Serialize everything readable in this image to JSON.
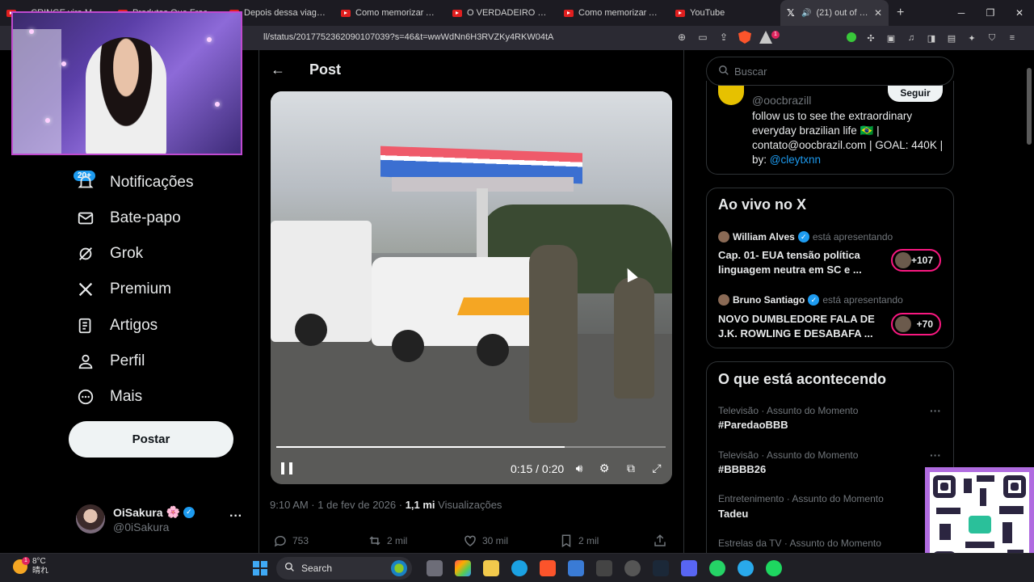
{
  "browser": {
    "tabs": [
      {
        "title": "... CRINGE vira MOD..."
      },
      {
        "title": "Produtos Que Fracas..."
      },
      {
        "title": "Depois dessa viagem, e..."
      },
      {
        "title": "Como memorizar ABSC..."
      },
      {
        "title": "O VERDADEIRO MOTIV..."
      },
      {
        "title": "Como memorizar ABSC..."
      },
      {
        "title": "YouTube"
      },
      {
        "title": "(21) out of cont..."
      }
    ],
    "new_tab": "+",
    "url": "ll/status/2017752362090107039?s=46&t=wwWdNn6H3RVZKy4RKW04tA",
    "notif_count": "1"
  },
  "nav": {
    "badge": "20+",
    "items": [
      {
        "label": "Notificações",
        "icon": "bell-icon"
      },
      {
        "label": "Bate-papo",
        "icon": "mail-icon"
      },
      {
        "label": "Grok",
        "icon": "grok-icon"
      },
      {
        "label": "Premium",
        "icon": "x-logo-icon"
      },
      {
        "label": "Artigos",
        "icon": "article-icon"
      },
      {
        "label": "Perfil",
        "icon": "person-icon"
      },
      {
        "label": "Mais",
        "icon": "more-circle-icon"
      }
    ],
    "post_button": "Postar",
    "profile": {
      "name": "OiSakura",
      "emoji": "🌸",
      "handle": "@0iSakura"
    }
  },
  "post": {
    "header": "Post",
    "video": {
      "time": "0:15 / 0:20",
      "progress": 0.74
    },
    "timestamp": "9:10 AM · 1 de fev de 2026 ·",
    "views_count": "1,1 mi",
    "views_label": "Visualizações",
    "actions": {
      "replies": "753",
      "reposts": "2 mil",
      "likes": "30 mil",
      "bookmarks": "2 mil"
    }
  },
  "sidebar": {
    "search_placeholder": "Buscar",
    "follow_card": {
      "handle": "@oocbrazill",
      "button": "Seguir",
      "bio": "follow us to see the extraordinary everyday brazilian life 🇧🇷 | contato@oocbrazil.com | GOAL: 440K | by:",
      "bio_link": "@cleytxnn"
    },
    "live": {
      "title": "Ao vivo no X",
      "items": [
        {
          "host": "William Alves",
          "status": "está apresentando",
          "title": "Cap. 01- EUA tensão política linguagem neutra em SC e ...",
          "count": "+107"
        },
        {
          "host": "Bruno Santiago",
          "status": "está apresentando",
          "title": "NOVO DUMBLEDORE FALA DE J.K. ROWLING E DESABAFA ...",
          "count": "+70"
        }
      ]
    },
    "trends": {
      "title": "O que está acontecendo",
      "items": [
        {
          "category": "Televisão · Assunto do Momento",
          "name": "#ParedaoBBB"
        },
        {
          "category": "Televisão · Assunto do Momento",
          "name": "#BBBB26"
        },
        {
          "category": "Entretenimento · Assunto do Momento",
          "name": "Tadeu"
        },
        {
          "category": "Estrelas da TV · Assunto do Momento",
          "name": ""
        }
      ]
    }
  },
  "taskbar": {
    "weather_temp": "8°C",
    "weather_desc": "晴れ",
    "weather_badge": "1",
    "search_label": "Search"
  },
  "colors": {
    "accent": "#1d9bf0",
    "live_ring": "#f91880",
    "background": "#000000"
  }
}
